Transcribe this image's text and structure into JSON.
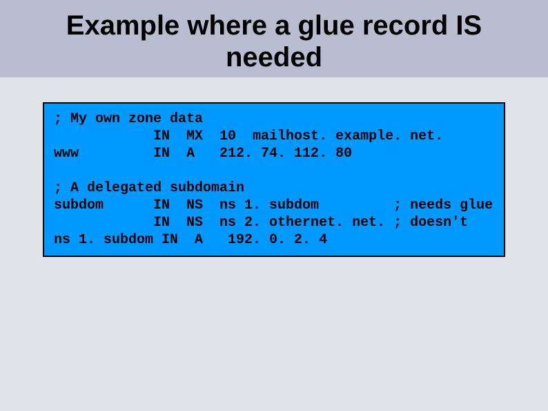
{
  "title_line1": "Example where a glue record IS",
  "title_line2": "needed",
  "code": {
    "c1": "; My own zone data",
    "c2": "            IN  MX  10  mailhost. example. net.",
    "c3": "www         IN  A   212. 74. 112. 80",
    "c4": "",
    "c5": "; A delegated subdomain",
    "c6": "subdom      IN  NS  ns 1. subdom         ; needs glue",
    "c7": "            IN  NS  ns 2. othernet. net. ; doesn't",
    "c8": "ns 1. subdom IN  A   192. 0. 2. 4"
  }
}
